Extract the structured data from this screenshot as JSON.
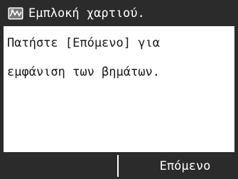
{
  "header": {
    "icon": "paper-jam-icon",
    "title": "Εμπλοκή χαρτιού."
  },
  "message": {
    "lines": [
      "Πατήστε [Επόμενο] για",
      "εμφάνιση των βημάτων."
    ]
  },
  "softkeys": {
    "left_label": "",
    "right_label": "Επόμενο"
  },
  "colors": {
    "frame": "#2b2b2b",
    "content_bg": "#ffffff",
    "text_dark": "#1a1a1a",
    "text_light": "#ffffff"
  }
}
